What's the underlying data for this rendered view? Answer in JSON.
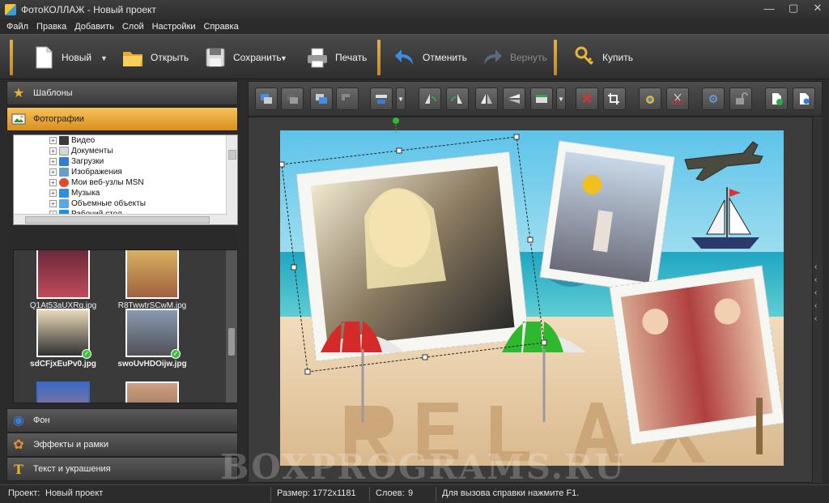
{
  "window": {
    "title": "ФотоКОЛЛАЖ - Новый проект"
  },
  "menu": [
    "Файл",
    "Правка",
    "Добавить",
    "Слой",
    "Настройки",
    "Справка"
  ],
  "toolbar": {
    "new": "Новый",
    "open": "Открыть",
    "save": "Сохранить",
    "print": "Печать",
    "undo": "Отменить",
    "redo": "Вернуть",
    "buy": "Купить"
  },
  "left_panel": {
    "templates": "Шаблоны",
    "photos": "Фотографии",
    "background": "Фон",
    "effects": "Эффекты и рамки",
    "text": "Текст и украшения"
  },
  "tree": {
    "items": [
      "Видео",
      "Документы",
      "Загрузки",
      "Изображения",
      "Мои веб-узлы MSN",
      "Музыка",
      "Объемные объекты",
      "Рабочий стол"
    ]
  },
  "thumbnails": {
    "items": [
      "Q1At53aUXRg.jpg",
      "R8TwwtrSCwM.jpg",
      "sdCFjxEuPv0.jpg",
      "swoUvHDOijw.jpg"
    ]
  },
  "canvas": {
    "watermark": "BOXPROGRAMS.RU"
  },
  "statusbar": {
    "project_label": "Проект:",
    "project_name": "Новый проект",
    "size_label": "Размер:",
    "size_value": "1772x1181",
    "layers_label": "Слоев:",
    "layers_value": "9",
    "help": "Для вызова справки нажмите F1."
  },
  "colors": {
    "accent": "#f0a830",
    "sea": "#2fb8c8",
    "sand": "#e8c89a"
  }
}
